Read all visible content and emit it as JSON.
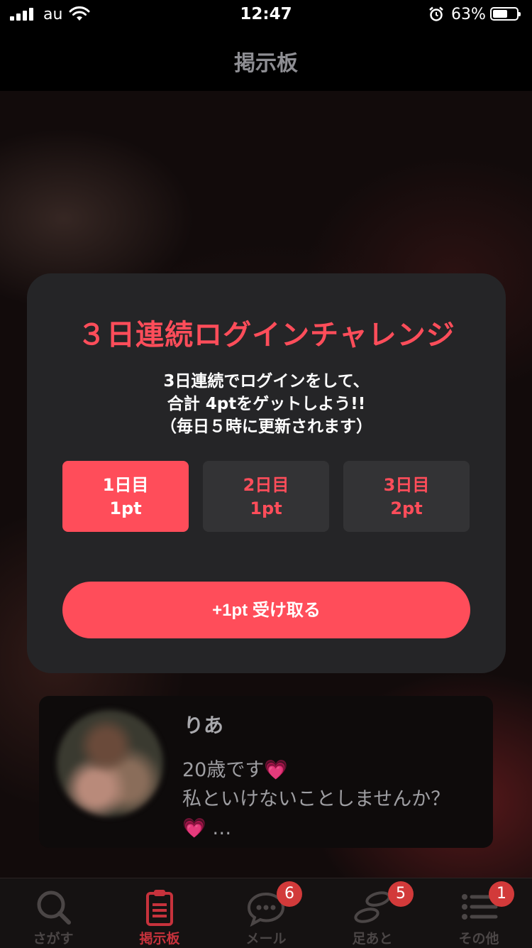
{
  "status_bar": {
    "carrier": "au",
    "time": "12:47",
    "battery_pct": "63%",
    "battery_level": 0.63
  },
  "nav": {
    "title": "掲示板"
  },
  "modal": {
    "title": "３日連続ログインチャレンジ",
    "desc_lines": [
      "3日連続でログインをして、",
      "合計 4ptをゲットしよう!!",
      "（毎日５時に更新されます）"
    ],
    "days": [
      {
        "day": "1日目",
        "points": "1pt",
        "active": true
      },
      {
        "day": "2日目",
        "points": "1pt",
        "active": false
      },
      {
        "day": "3日目",
        "points": "2pt",
        "active": false
      }
    ],
    "claim_label": "+1pt 受け取る"
  },
  "post": {
    "name": "りあ",
    "line1": "20歳です",
    "line2": "私といけないことしませんか？",
    "line3_suffix": " …",
    "heart_emoji": "💗"
  },
  "tabs": [
    {
      "label": "さがす",
      "icon": "search-icon"
    },
    {
      "label": "掲示板",
      "icon": "clipboard-icon",
      "active": true
    },
    {
      "label": "メール",
      "icon": "chat-bubble-icon",
      "badge": "6"
    },
    {
      "label": "足あと",
      "icon": "footprints-icon",
      "badge": "5"
    },
    {
      "label": "その他",
      "icon": "list-icon",
      "badge": "1"
    }
  ],
  "colors": {
    "accent": "#ff4d5a",
    "modal_bg": "#252527",
    "tab_active": "#c7323c",
    "badge": "#d23a3a"
  }
}
